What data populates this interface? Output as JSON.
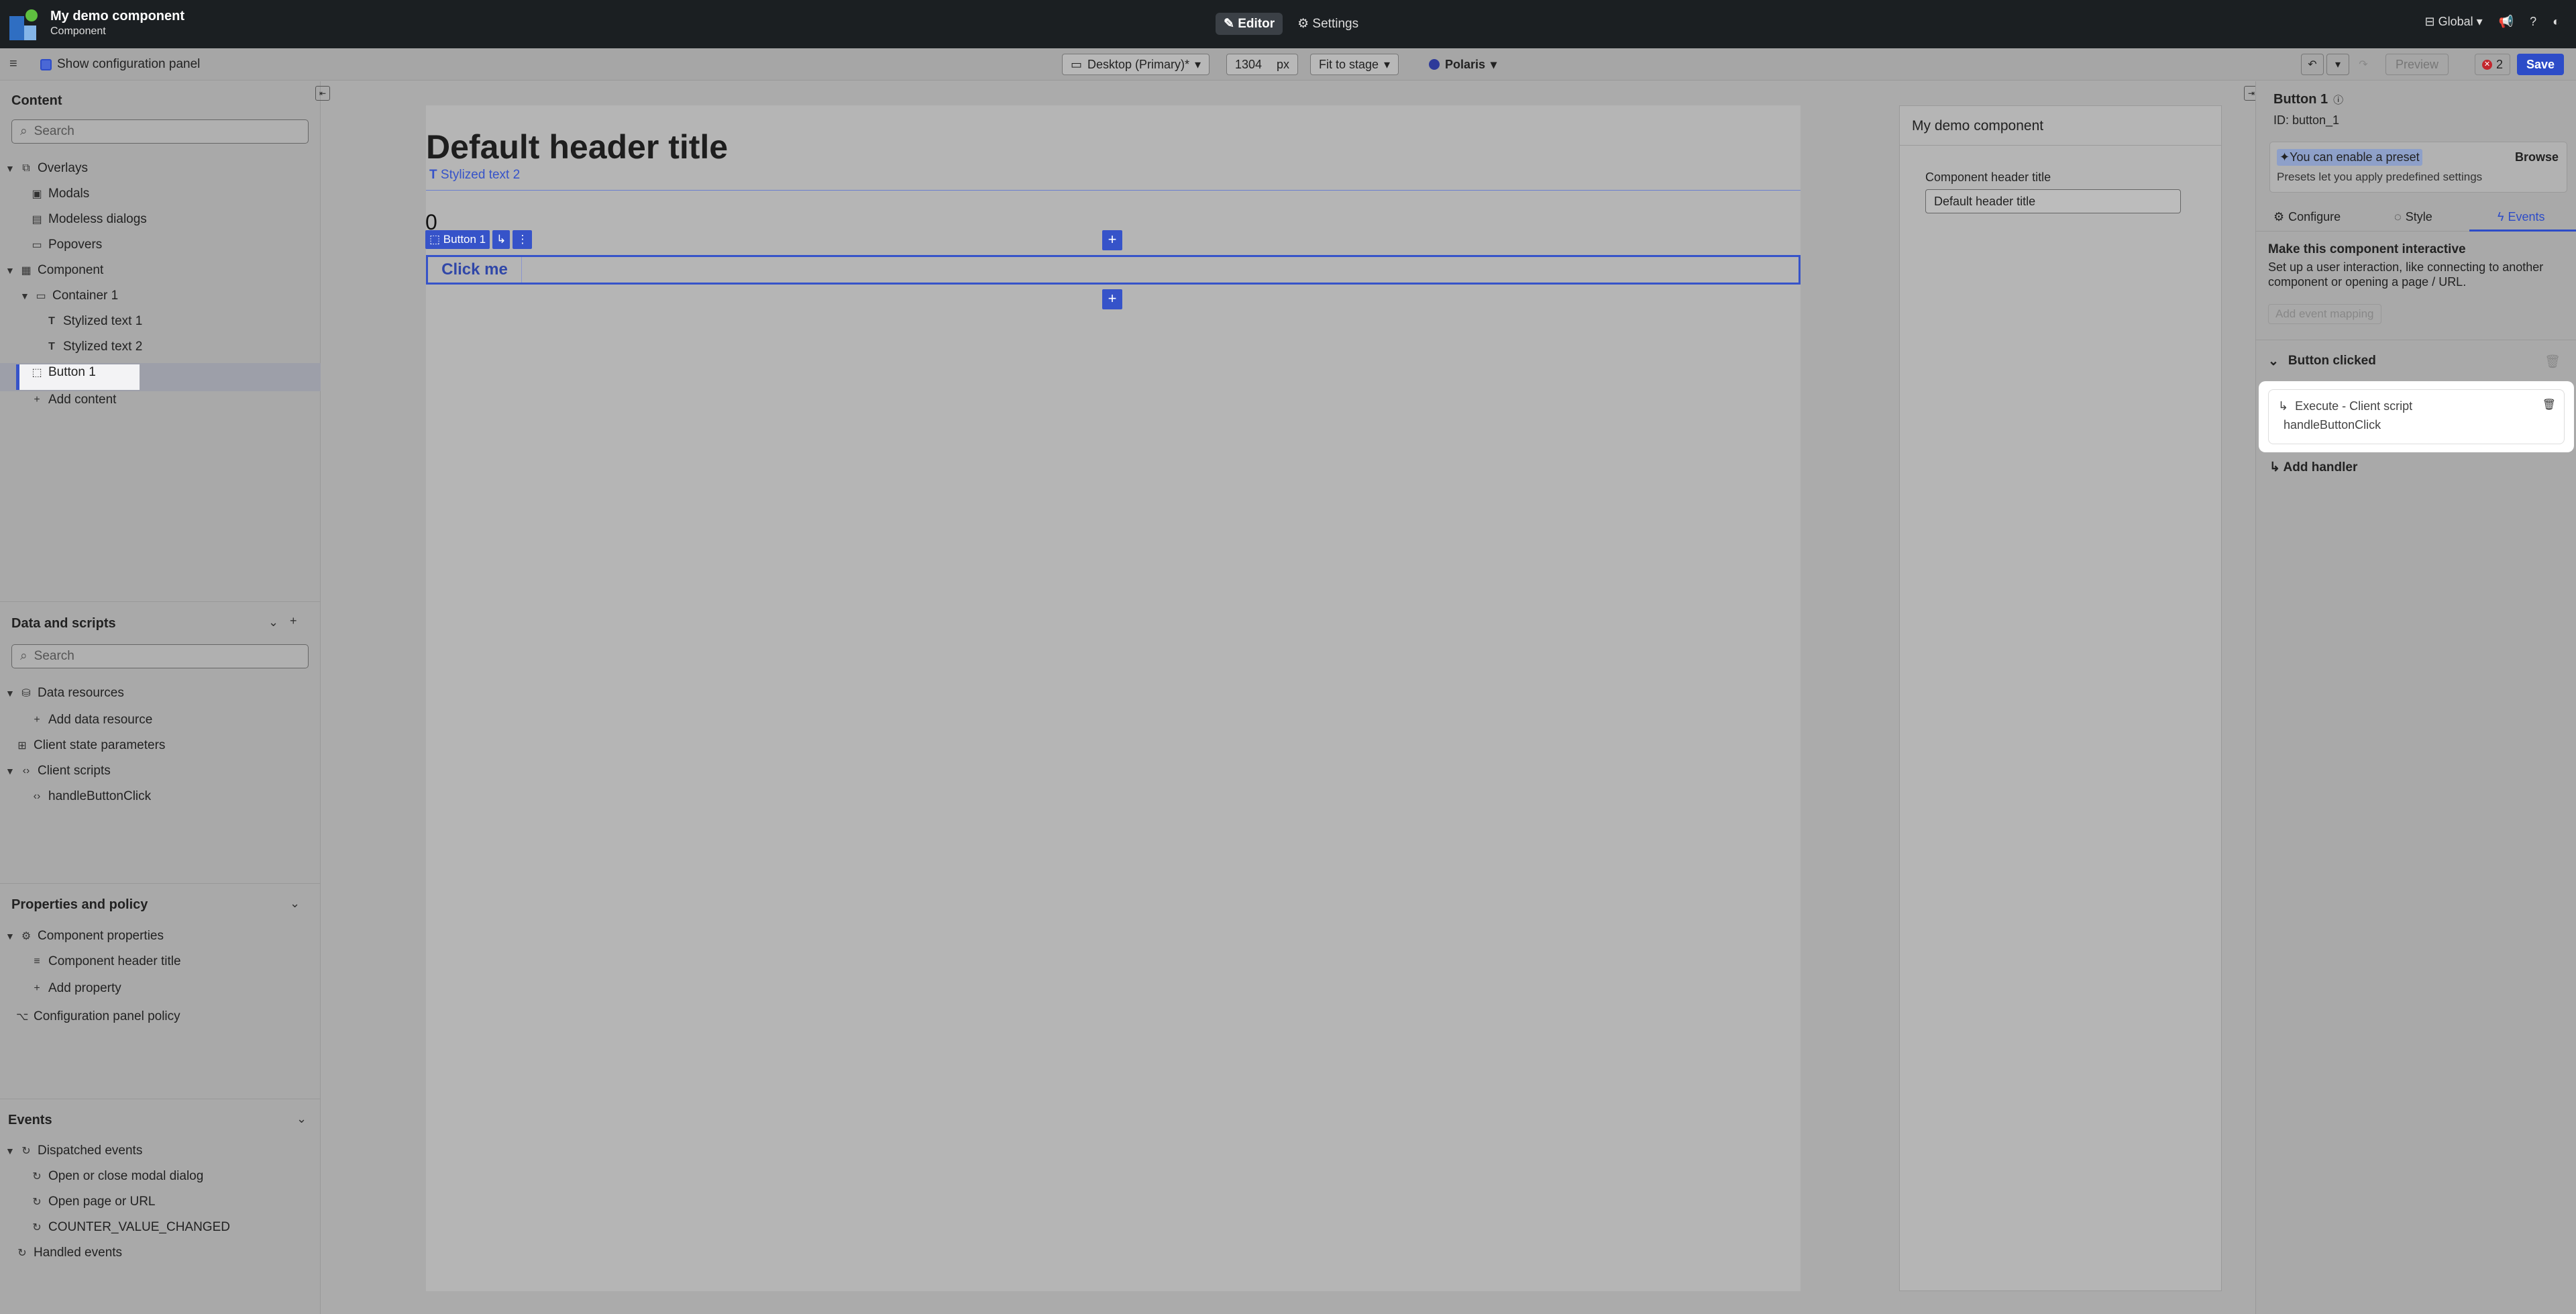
{
  "topbar": {
    "app_title": "My demo component",
    "app_subtitle": "Component",
    "tabs": [
      {
        "label": "Editor",
        "icon": "pencil-icon"
      },
      {
        "label": "Settings",
        "icon": "gear-icon"
      }
    ],
    "scope_label": "Global"
  },
  "toolbar": {
    "show_config_label": "Show configuration panel",
    "device": "Desktop (Primary)*",
    "width_value": "1304",
    "width_unit": "px",
    "fit": "Fit to stage",
    "theme": "Polaris",
    "error_count": "2",
    "preview_label": "Preview",
    "save_label": "Save"
  },
  "content_panel": {
    "title": "Content",
    "search_placeholder": "Search",
    "items": [
      {
        "label": "Overlays"
      },
      {
        "label": "Modals"
      },
      {
        "label": "Modeless dialogs"
      },
      {
        "label": "Popovers"
      },
      {
        "label": "Component"
      },
      {
        "label": "Container 1"
      },
      {
        "label": "Stylized text 1"
      },
      {
        "label": "Stylized text 2"
      },
      {
        "label": "Button 1"
      },
      {
        "label": "Add content"
      }
    ]
  },
  "data_panel": {
    "title": "Data and scripts",
    "search_placeholder": "Search",
    "items": [
      {
        "label": "Data resources"
      },
      {
        "label": "Add data resource"
      },
      {
        "label": "Client state parameters"
      },
      {
        "label": "Client scripts"
      },
      {
        "label": "handleButtonClick"
      }
    ]
  },
  "props_panel": {
    "title": "Properties and policy",
    "items": [
      {
        "label": "Component properties"
      },
      {
        "label": "Component header title"
      },
      {
        "label": "Add property"
      },
      {
        "label": "Configuration panel policy"
      }
    ]
  },
  "events_panel": {
    "title": "Events",
    "items": [
      {
        "label": "Dispatched events"
      },
      {
        "label": "Open or close modal dialog"
      },
      {
        "label": "Open page or URL"
      },
      {
        "label": "COUNTER_VALUE_CHANGED"
      },
      {
        "label": "Handled events"
      }
    ]
  },
  "stage": {
    "header_title": "Default header title",
    "stylized_tag": "Stylized text 2",
    "counter": "0",
    "button_tag": "Button 1",
    "button_label": "Click me"
  },
  "config_preview": {
    "title": "My demo component",
    "field_label": "Component header title",
    "field_value": "Default header title"
  },
  "right_panel": {
    "title": "Button 1",
    "id_text": "ID: button_1",
    "preset_text": "You can enable a preset",
    "preset_browse": "Browse",
    "preset_desc": "Presets let you apply predefined settings",
    "tabs": [
      {
        "label": "Configure"
      },
      {
        "label": "Style"
      },
      {
        "label": "Events"
      }
    ],
    "events_heading": "Make this component interactive",
    "events_desc": "Set up a user interaction, like connecting to another component or opening a page / URL.",
    "add_mapping": "Add event mapping",
    "event_name": "Button clicked",
    "handler_action": "Execute - Client script",
    "handler_name": "handleButtonClick",
    "add_handler": "Add handler"
  }
}
